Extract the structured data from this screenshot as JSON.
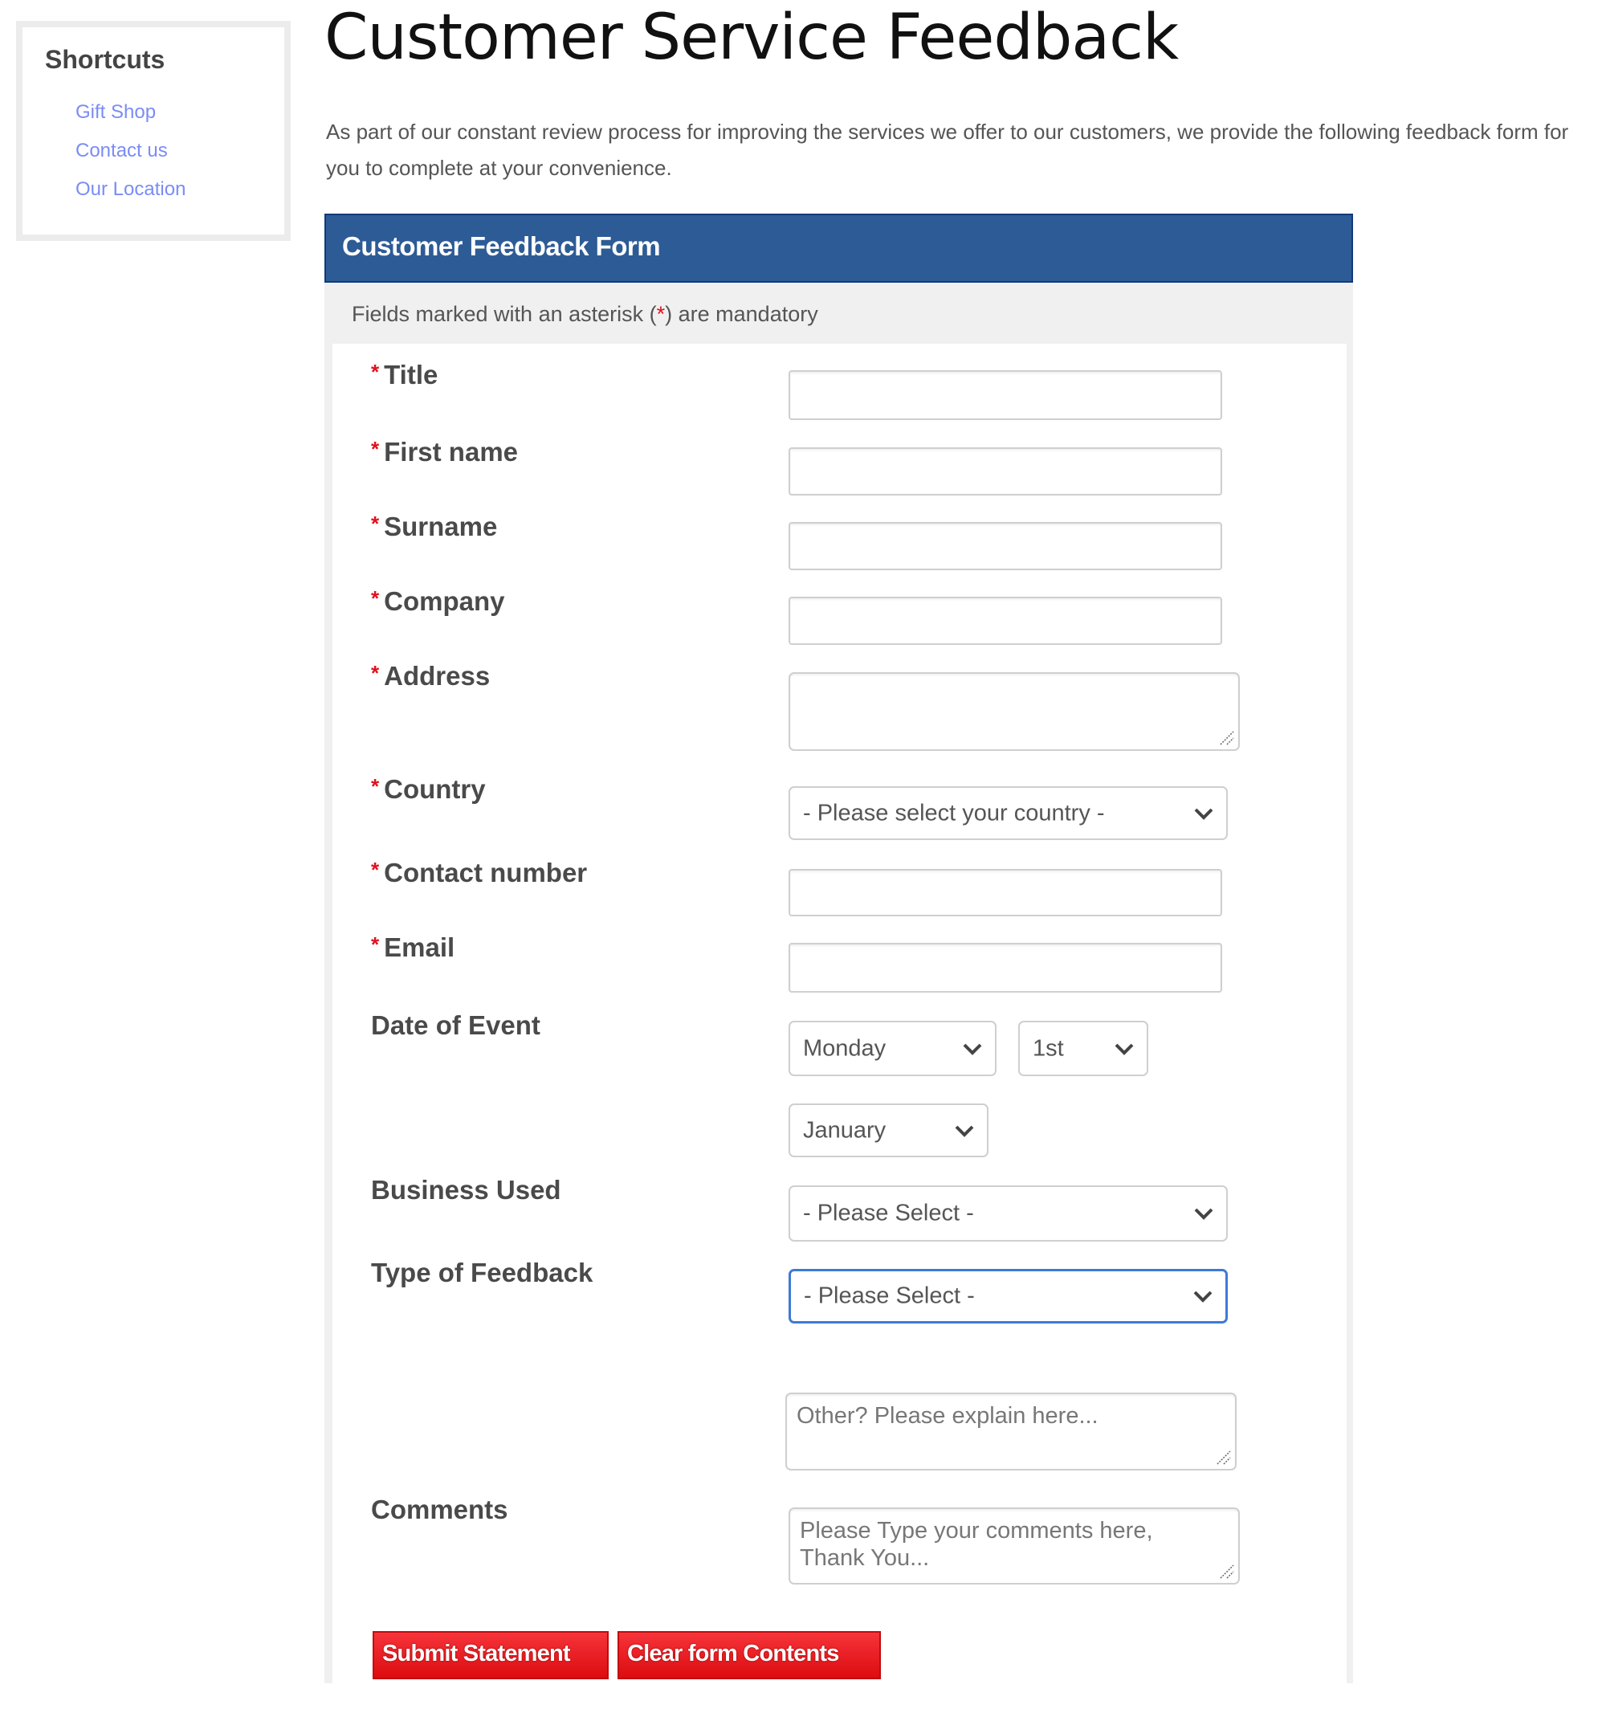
{
  "sidebar": {
    "title": "Shortcuts",
    "links": [
      "Gift Shop",
      "Contact us",
      "Our Location"
    ]
  },
  "page": {
    "title": "Customer Service Feedback",
    "intro": "As part of our constant review process for improving the services we offer to our customers, we provide the following feedback form for you to complete at your convenience."
  },
  "form": {
    "header": "Customer Feedback Form",
    "mandatory_prefix": "Fields marked with an asterisk (",
    "mandatory_asterisk": "*",
    "mandatory_suffix": ") are mandatory",
    "required_mark": "*",
    "fields": {
      "title": {
        "label": "Title",
        "value": ""
      },
      "first_name": {
        "label": "First name",
        "value": ""
      },
      "surname": {
        "label": "Surname",
        "value": ""
      },
      "company": {
        "label": "Company",
        "value": ""
      },
      "address": {
        "label": "Address",
        "value": ""
      },
      "country": {
        "label": "Country",
        "selected": "- Please select your country -"
      },
      "contact_number": {
        "label": "Contact number",
        "value": ""
      },
      "email": {
        "label": "Email",
        "value": ""
      },
      "date_of_event": {
        "label": "Date of Event",
        "day_of_week": "Monday",
        "day": "1st",
        "month": "January"
      },
      "business_used": {
        "label": "Business Used",
        "selected": "- Please Select -"
      },
      "type_of_feedback": {
        "label": "Type of Feedback",
        "selected": "- Please Select -"
      },
      "other": {
        "placeholder": "Other? Please explain here..."
      },
      "comments": {
        "label": "Comments",
        "placeholder": "Please Type your comments here, Thank You..."
      }
    },
    "buttons": {
      "submit": "Submit Statement",
      "clear": "Clear form Contents"
    }
  },
  "colors": {
    "header_bg": "#2d5b96",
    "button_red": "#e81c22",
    "required_red": "#e0101e",
    "link_blue": "#7a8cf5",
    "focus_blue": "#3d7ad6"
  }
}
